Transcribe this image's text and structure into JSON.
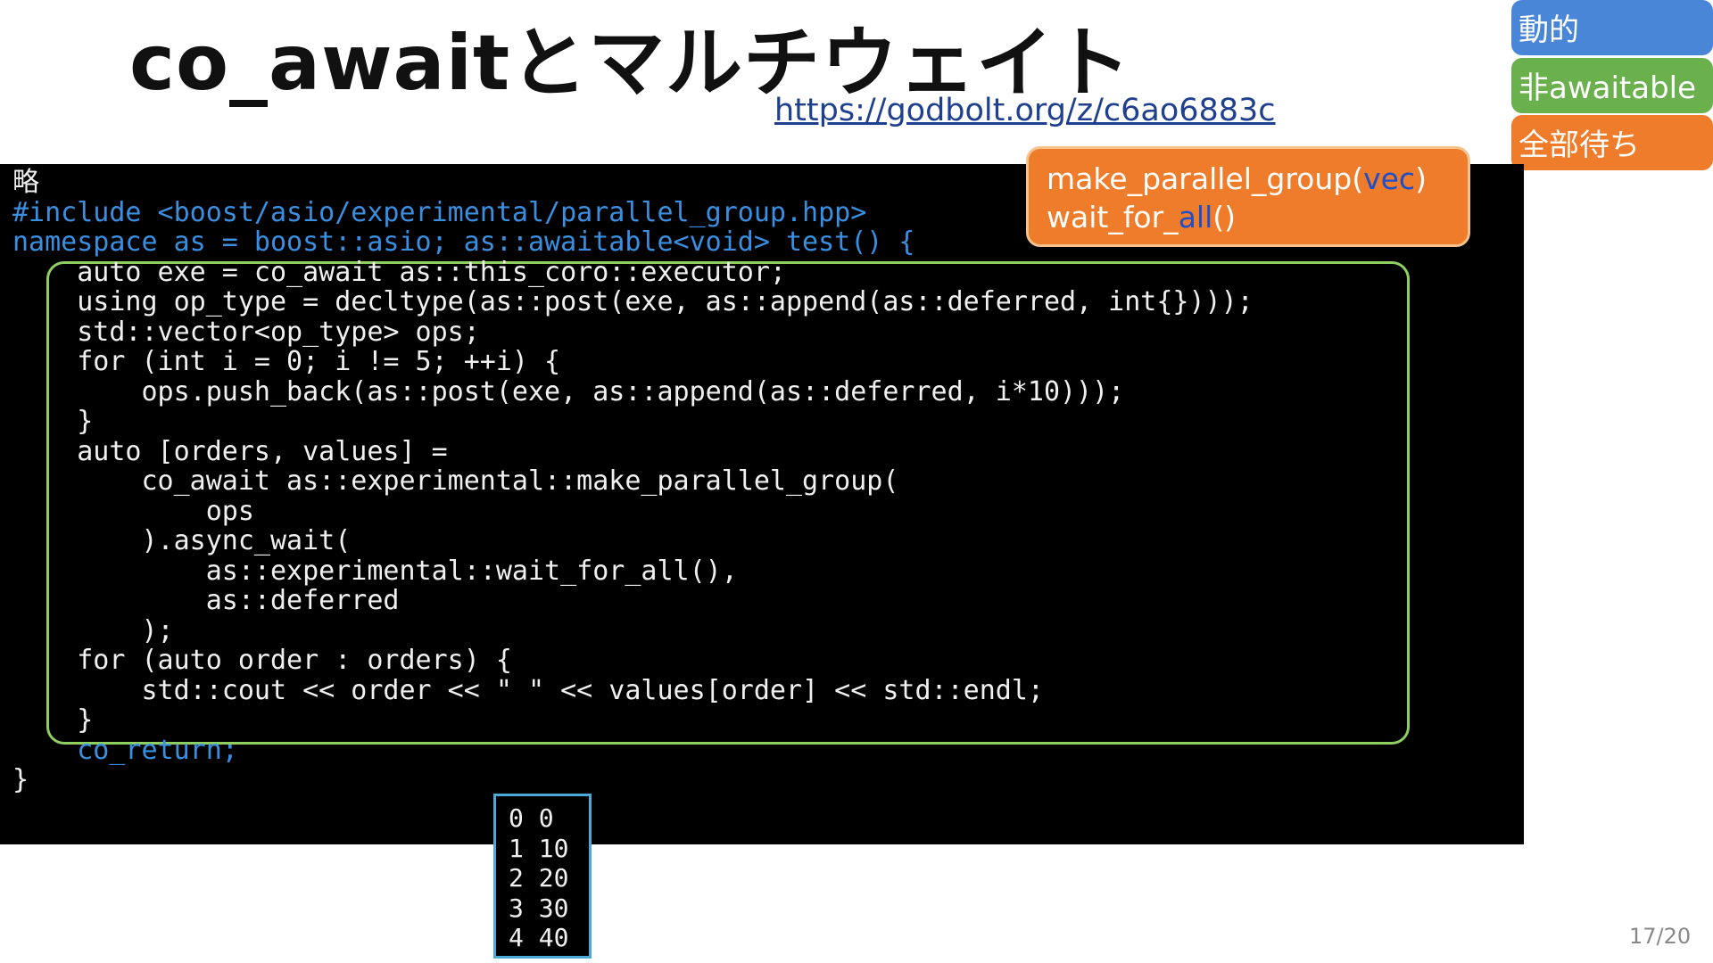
{
  "slide": {
    "title": "co_awaitとマルチウェイト",
    "link": "https://godbolt.org/z/c6ao6883c",
    "page": "17/20"
  },
  "tags": [
    {
      "label": "動的",
      "color": "#4a86d8"
    },
    {
      "label": "非awaitable",
      "color": "#6ab04c"
    },
    {
      "label": "全部待ち",
      "color": "#ef7c2a"
    }
  ],
  "callout": {
    "line1_a": "make_parallel_group(",
    "line1_b": "vec",
    "line1_c": ")",
    "line2_a": "wait_for_",
    "line2_b": "all",
    "line2_c": "()"
  },
  "code": {
    "lines": [
      "略",
      "#include <boost/asio/experimental/parallel_group.hpp>",
      "namespace as = boost::asio; as::awaitable<void> test() {",
      "    auto exe = co_await as::this_coro::executor;",
      "    using op_type = decltype(as::post(exe, as::append(as::deferred, int{})));",
      "    std::vector<op_type> ops;",
      "    for (int i = 0; i != 5; ++i) {",
      "        ops.push_back(as::post(exe, as::append(as::deferred, i*10)));",
      "    }",
      "    auto [orders, values] =",
      "        co_await as::experimental::make_parallel_group(",
      "            ops",
      "        ).async_wait(",
      "            as::experimental::wait_for_all(),",
      "            as::deferred",
      "        );",
      "    for (auto order : orders) {",
      "        std::cout << order << \" \" << values[order] << std::endl;",
      "    }",
      "    co_return;",
      "}"
    ]
  },
  "output": {
    "lines": [
      "0 0",
      "1 10",
      "2 20",
      "3 30",
      "4 40"
    ]
  },
  "colors": {
    "keyword": "#3a8fe0",
    "include": "#f0a3a3",
    "highlight_border": "#8fcf5f",
    "callout_bg": "#ef7c2a"
  }
}
